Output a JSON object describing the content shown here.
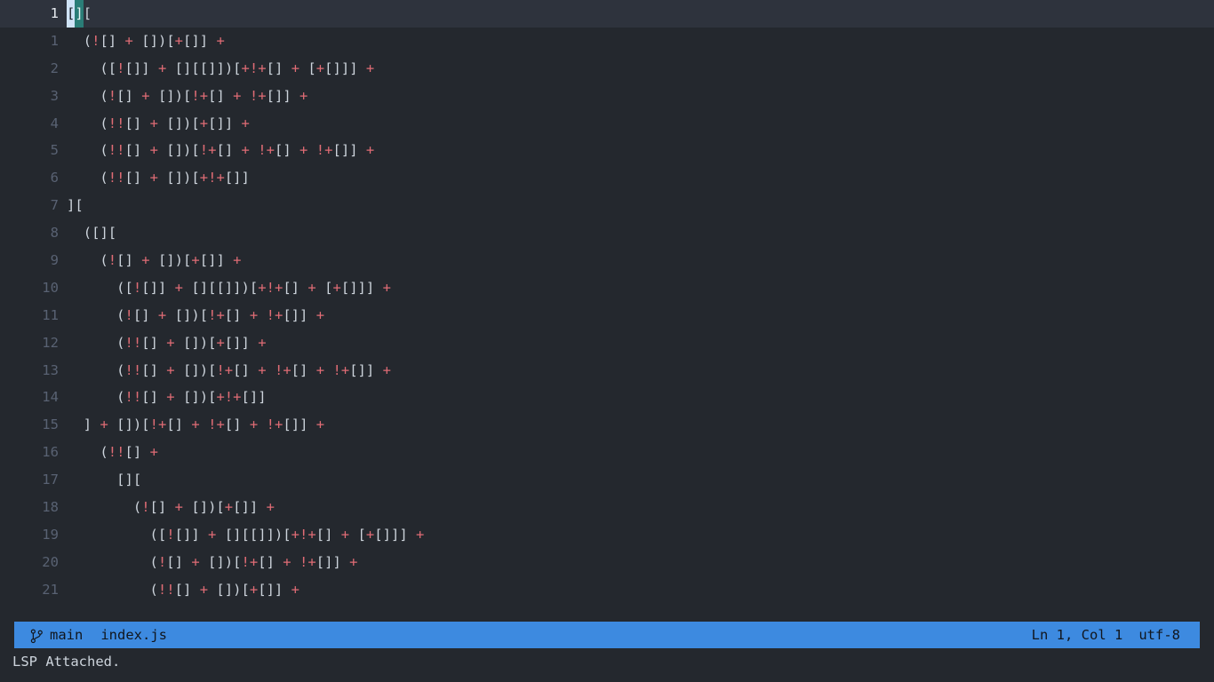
{
  "theme": {
    "editor_bg": "#24282e",
    "current_line_bg": "#2e333d",
    "gutter_fg": "#596273",
    "gutter_current_fg": "#e7ebf0",
    "punctuation_fg": "#cdd4dc",
    "operator_fg": "#e06c75",
    "cursor_bg": "#cfe3f7",
    "matching_bracket_bg": "#2a7d77",
    "statusbar_bg": "#3d8ae0",
    "statusbar_fg": "#11161d",
    "message_fg": "#cdd4dc"
  },
  "editor": {
    "lines": [
      {
        "number": "1",
        "current": true,
        "indent": 0,
        "text": "[][",
        "cursor_at": 0,
        "match_at": 1
      },
      {
        "number": "1",
        "current": false,
        "indent": 1,
        "text": "(![] + [])[+[]] +"
      },
      {
        "number": "2",
        "current": false,
        "indent": 2,
        "text": "([![]] + [][[]])[+!+[] + [+[]]] +"
      },
      {
        "number": "3",
        "current": false,
        "indent": 2,
        "text": "(![] + [])[!+[] + !+[]] +"
      },
      {
        "number": "4",
        "current": false,
        "indent": 2,
        "text": "(!![] + [])[+[]] +"
      },
      {
        "number": "5",
        "current": false,
        "indent": 2,
        "text": "(!![] + [])[!+[] + !+[] + !+[]] +"
      },
      {
        "number": "6",
        "current": false,
        "indent": 2,
        "text": "(!![] + [])[+!+[]]"
      },
      {
        "number": "7",
        "current": false,
        "indent": 0,
        "text": "]["
      },
      {
        "number": "8",
        "current": false,
        "indent": 1,
        "text": "([]["
      },
      {
        "number": "9",
        "current": false,
        "indent": 2,
        "text": "(![] + [])[+[]] +"
      },
      {
        "number": "10",
        "current": false,
        "indent": 3,
        "text": "([![]] + [][[]])[+!+[] + [+[]]] +"
      },
      {
        "number": "11",
        "current": false,
        "indent": 3,
        "text": "(![] + [])[!+[] + !+[]] +"
      },
      {
        "number": "12",
        "current": false,
        "indent": 3,
        "text": "(!![] + [])[+[]] +"
      },
      {
        "number": "13",
        "current": false,
        "indent": 3,
        "text": "(!![] + [])[!+[] + !+[] + !+[]] +"
      },
      {
        "number": "14",
        "current": false,
        "indent": 3,
        "text": "(!![] + [])[+!+[]]"
      },
      {
        "number": "15",
        "current": false,
        "indent": 1,
        "text": "] + [])[!+[] + !+[] + !+[]] +"
      },
      {
        "number": "16",
        "current": false,
        "indent": 2,
        "text": "(!![] +"
      },
      {
        "number": "17",
        "current": false,
        "indent": 3,
        "text": "[]["
      },
      {
        "number": "18",
        "current": false,
        "indent": 4,
        "text": "(![] + [])[+[]] +"
      },
      {
        "number": "19",
        "current": false,
        "indent": 5,
        "text": "([![]] + [][[]])[+!+[] + [+[]]] +"
      },
      {
        "number": "20",
        "current": false,
        "indent": 5,
        "text": "(![] + [])[!+[] + !+[]] +"
      },
      {
        "number": "21",
        "current": false,
        "indent": 5,
        "text": "(!![] + [])[+[]] +"
      }
    ]
  },
  "statusbar": {
    "branch_icon": "git-branch-icon",
    "branch": "main",
    "filename": "index.js",
    "position": "Ln 1, Col 1",
    "encoding": "utf-8"
  },
  "message": {
    "text": "LSP Attached."
  }
}
